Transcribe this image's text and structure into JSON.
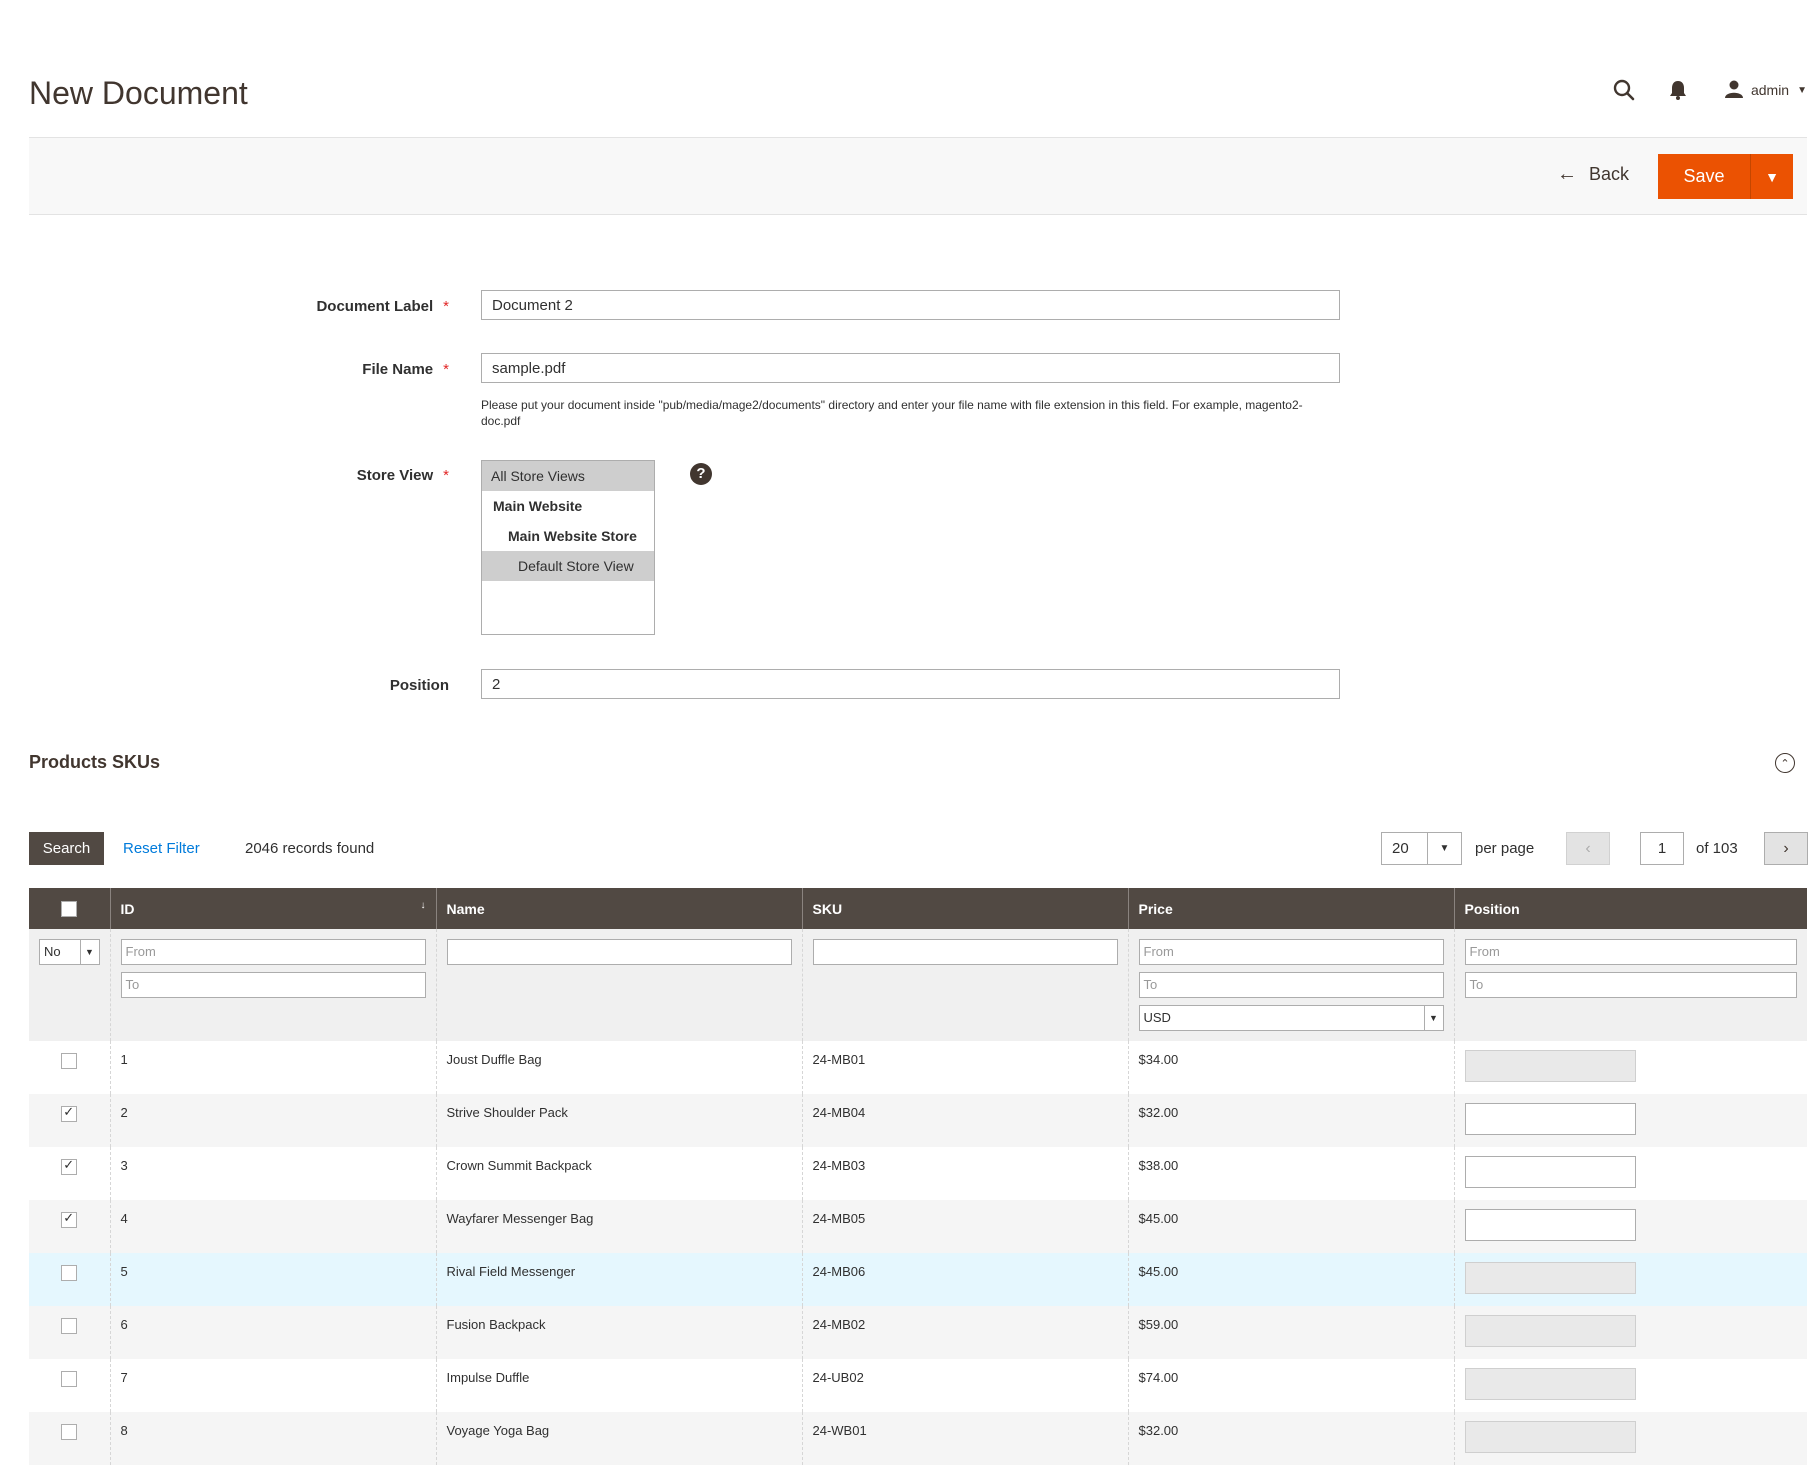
{
  "header": {
    "title": "New Document",
    "user": "admin"
  },
  "actions": {
    "back": "Back",
    "save": "Save"
  },
  "form": {
    "document_label": {
      "label": "Document Label",
      "value": "Document 2"
    },
    "file_name": {
      "label": "File Name",
      "value": "sample.pdf",
      "note": "Please put your document inside \"pub/media/mage2/documents\" directory and enter your file name with file extension in this field. For example, magento2-doc.pdf"
    },
    "store_view": {
      "label": "Store View",
      "options": [
        "All Store Views",
        "Main Website",
        "Main Website Store",
        "Default Store View"
      ]
    },
    "position": {
      "label": "Position",
      "value": "2"
    },
    "required_mark": "*"
  },
  "section": {
    "title": "Products SKUs"
  },
  "grid_actions": {
    "search": "Search",
    "reset": "Reset Filter",
    "records": "2046 records found",
    "per_page_value": "20",
    "per_page_label": "per page",
    "page": "1",
    "of_pages": "of 103"
  },
  "columns": [
    "ID",
    "Name",
    "SKU",
    "Price",
    "Position"
  ],
  "filters": {
    "in_products": "No",
    "from": "From",
    "to": "To",
    "currency": "USD"
  },
  "rows": [
    {
      "id": "1",
      "name": "Joust Duffle Bag",
      "sku": "24-MB01",
      "price": "$34.00"
    },
    {
      "id": "2",
      "name": "Strive Shoulder Pack",
      "sku": "24-MB04",
      "price": "$32.00"
    },
    {
      "id": "3",
      "name": "Crown Summit Backpack",
      "sku": "24-MB03",
      "price": "$38.00"
    },
    {
      "id": "4",
      "name": "Wayfarer Messenger Bag",
      "sku": "24-MB05",
      "price": "$45.00"
    },
    {
      "id": "5",
      "name": "Rival Field Messenger",
      "sku": "24-MB06",
      "price": "$45.00"
    },
    {
      "id": "6",
      "name": "Fusion Backpack",
      "sku": "24-MB02",
      "price": "$59.00"
    },
    {
      "id": "7",
      "name": "Impulse Duffle",
      "sku": "24-UB02",
      "price": "$74.00"
    },
    {
      "id": "8",
      "name": "Voyage Yoga Bag",
      "sku": "24-WB01",
      "price": "$32.00"
    }
  ],
  "icons": {
    "search": "search-icon",
    "notifications": "bell-icon",
    "user": "user-icon",
    "help": "help-icon",
    "collapse": "chevron-up-icon"
  },
  "colors": {
    "accent": "#eb5202",
    "grid_header": "#514943",
    "link": "#007bdb"
  }
}
